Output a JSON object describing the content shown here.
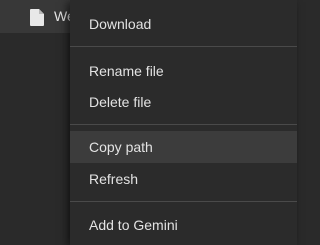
{
  "file": {
    "name": "We",
    "icon": "file-icon"
  },
  "context_menu": {
    "items": [
      {
        "label": "Download"
      },
      {
        "label": "Rename file"
      },
      {
        "label": "Delete file"
      },
      {
        "label": "Copy path",
        "highlighted": true
      },
      {
        "label": "Refresh"
      },
      {
        "label": "Add to Gemini"
      }
    ]
  },
  "colors": {
    "background": "#2a2a2a",
    "row_background": "#383838",
    "menu_background": "#2b2b2b",
    "highlight": "#3c3c3c",
    "separator": "#4a4a4a",
    "text": "#e3e3e3"
  }
}
